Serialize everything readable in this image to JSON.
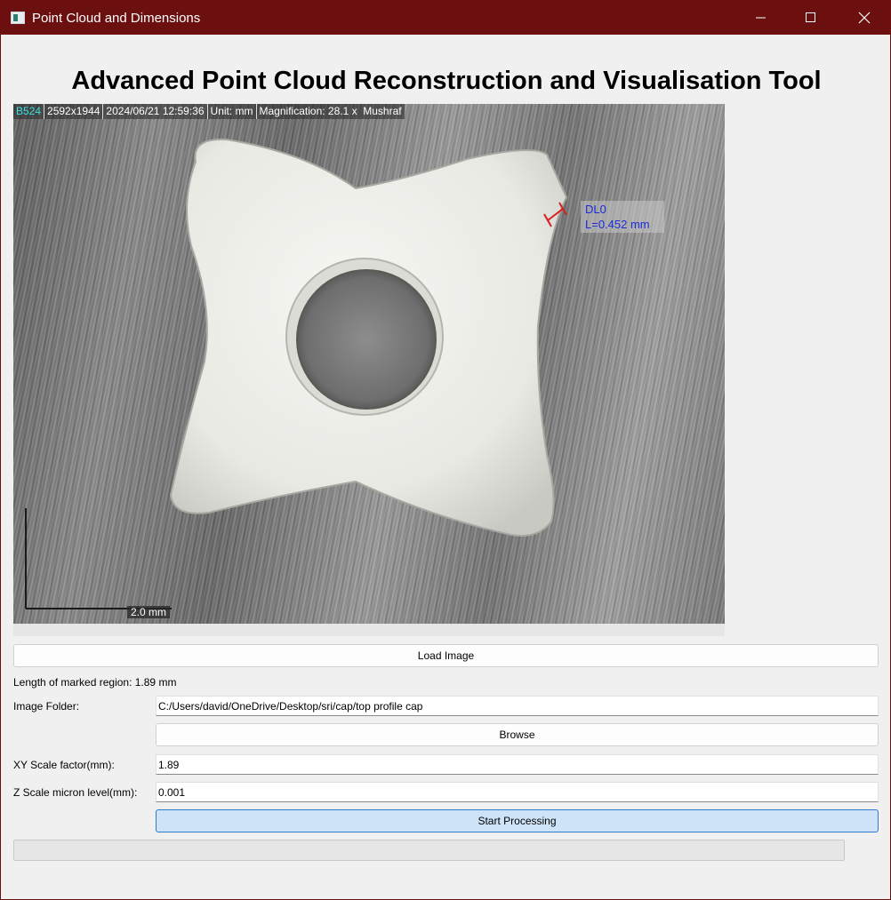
{
  "window": {
    "title": "Point Cloud and Dimensions"
  },
  "heading": "Advanced Point Cloud Reconstruction and Visualisation Tool",
  "image_overlay": {
    "camera_code": "B524",
    "resolution": "2592x1944",
    "datetime": "2024/06/21 12:59:36",
    "unit": "Unit: mm",
    "magnification": "Magnification:  28.1 x",
    "user": "Mushraf",
    "dimension_name": "DL0",
    "dimension_value": "L=0.452 mm",
    "scale_bar_label": "2.0 mm"
  },
  "controls": {
    "load_image_label": "Load Image",
    "marked_region_text": "Length of marked region: 1.89 mm",
    "image_folder_label": "Image Folder:",
    "image_folder_value": "C:/Users/david/OneDrive/Desktop/sri/cap/top profile cap",
    "browse_label": "Browse",
    "xy_scale_label": "XY Scale factor(mm):",
    "xy_scale_value": "1.89",
    "z_scale_label": "Z Scale micron level(mm):",
    "z_scale_value": "0.001",
    "start_label": "Start Processing"
  },
  "progress": {
    "fraction": 0
  },
  "colors": {
    "titlebar": "#6b0f0f",
    "dimension_text": "#1a2bd8",
    "dimension_marker": "#d42020",
    "primary_button": "#cfe3f8"
  },
  "icons": {
    "app": "window-app-icon",
    "minimize": "minimize-icon",
    "maximize": "maximize-icon",
    "close": "close-icon"
  }
}
